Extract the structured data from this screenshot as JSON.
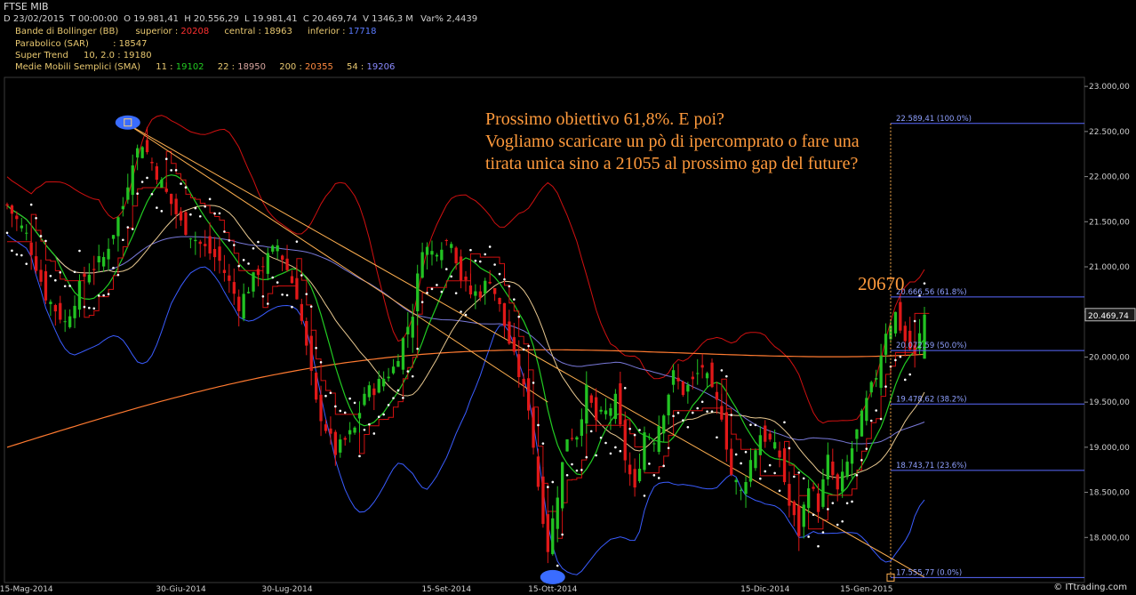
{
  "title": "FTSE MIB",
  "header_line": {
    "date": "D 23/02/2015",
    "time": "T 00:00:00",
    "open": "O 19.981,41",
    "high": "H 20.556,29",
    "low": "L 19.981,41",
    "close": "C 20.469,74",
    "volume": "V 1346,3 M",
    "var": "Var% 2,4439"
  },
  "indicators": {
    "bb_label": "Bande di Bollinger (BB)",
    "bb_sup_label": "superior :",
    "bb_sup": "20208",
    "bb_cen_label": "central :",
    "bb_cen": "18963",
    "bb_inf_label": "inferior :",
    "bb_inf": "17718",
    "sar_label": "Parabolico (SAR)",
    "sar_sep": ":",
    "sar": "18547",
    "st_label": "Super Trend",
    "st_params": "10, 2.0 :",
    "st": "19180",
    "sma_label": "Medie Mobili Semplici (SMA)",
    "sma": [
      {
        "period": "11 :",
        "value": "19102"
      },
      {
        "period": "22 :",
        "value": "18950"
      },
      {
        "period": "200 :",
        "value": "20355"
      },
      {
        "period": "54 :",
        "value": "19206"
      }
    ]
  },
  "colors": {
    "background": "#000000",
    "bull_candle": "#22c222",
    "bear_candle": "#e01818",
    "bb_upper": "#d01010",
    "bb_lower": "#3a5cff",
    "sma11": "#22cc22",
    "sma22": "#e8c890",
    "sma200": "#ff7a30",
    "sma54": "#7878d8",
    "supertrend": "#d01010",
    "sar": "#ffffff",
    "fib": "#5a6aff",
    "trendline": "#ffb050",
    "annotation": "#ff9a3c",
    "grid": "#2a2a2a"
  },
  "annotation": {
    "line1": "Prossimo obiettivo 61,8%. E poi?",
    "line2": "Vogliamo scaricare un pò di ipercomprato o fare una",
    "line3": "tirata unica sino a 21055 al prossimo gap del future?",
    "target": "20670"
  },
  "fib_levels": [
    {
      "label": "22.589,41 (100.0%)",
      "value": 22589.41
    },
    {
      "label": "20.666,56 (61.8%)",
      "value": 20666.56
    },
    {
      "label": "20.072,59 (50.0%)",
      "value": 20072.59
    },
    {
      "label": "19.478,62 (38.2%)",
      "value": 19478.62
    },
    {
      "label": "18.743,71 (23.6%)",
      "value": 18743.71
    },
    {
      "label": "17.555,77 (0.0%)",
      "value": 17555.77
    }
  ],
  "last_price_label": "20.469,74",
  "watermark": "© ITtrading.com",
  "chart_data": {
    "type": "candlestick",
    "title": "FTSE MIB",
    "ylim": [
      17500,
      23100
    ],
    "y_ticks": [
      {
        "label": "23.000,00",
        "value": 23000
      },
      {
        "label": "22.500,00",
        "value": 22500
      },
      {
        "label": "22.000,00",
        "value": 22000
      },
      {
        "label": "21.500,00",
        "value": 21500
      },
      {
        "label": "21.000,00",
        "value": 21000
      },
      {
        "label": "20.500,00",
        "value": 20500
      },
      {
        "label": "20.000,00",
        "value": 20000
      },
      {
        "label": "19.500,00",
        "value": 19500
      },
      {
        "label": "19.000,00",
        "value": 19000
      },
      {
        "label": "18.500,00",
        "value": 18500
      },
      {
        "label": "18.000,00",
        "value": 18000
      }
    ],
    "x_labels": [
      {
        "label": "15-Mag-2014",
        "index": 4
      },
      {
        "label": "30-Giu-2014",
        "index": 36
      },
      {
        "label": "30-Lug-2014",
        "index": 58
      },
      {
        "label": "15-Set-2014",
        "index": 91
      },
      {
        "label": "15-Ott-2014",
        "index": 113
      },
      {
        "label": "15-Dic-2014",
        "index": 157
      },
      {
        "label": "15-Gen-2015",
        "index": 178
      }
    ],
    "n_bars": 191,
    "close_anchors": [
      [
        0,
        21680
      ],
      [
        4,
        21350
      ],
      [
        8,
        20680
      ],
      [
        12,
        20380
      ],
      [
        16,
        20900
      ],
      [
        20,
        21100
      ],
      [
        24,
        21680
      ],
      [
        26,
        22200
      ],
      [
        28,
        22380
      ],
      [
        30,
        22150
      ],
      [
        32,
        21920
      ],
      [
        36,
        21480
      ],
      [
        40,
        21250
      ],
      [
        44,
        21060
      ],
      [
        48,
        20580
      ],
      [
        52,
        20960
      ],
      [
        56,
        21240
      ],
      [
        60,
        20700
      ],
      [
        64,
        19480
      ],
      [
        68,
        18950
      ],
      [
        72,
        19200
      ],
      [
        74,
        19600
      ],
      [
        76,
        19650
      ],
      [
        80,
        19880
      ],
      [
        84,
        20500
      ],
      [
        86,
        21240
      ],
      [
        88,
        21160
      ],
      [
        90,
        21260
      ],
      [
        92,
        21320
      ],
      [
        94,
        20880
      ],
      [
        96,
        20700
      ],
      [
        98,
        20720
      ],
      [
        100,
        20880
      ],
      [
        102,
        20550
      ],
      [
        104,
        20160
      ],
      [
        108,
        19460
      ],
      [
        110,
        18580
      ],
      [
        112,
        17880
      ],
      [
        114,
        18500
      ],
      [
        116,
        19120
      ],
      [
        118,
        19150
      ],
      [
        120,
        19620
      ],
      [
        122,
        19300
      ],
      [
        124,
        19380
      ],
      [
        126,
        19520
      ],
      [
        128,
        18880
      ],
      [
        130,
        18500
      ],
      [
        132,
        19170
      ],
      [
        134,
        19100
      ],
      [
        136,
        19420
      ],
      [
        138,
        19800
      ],
      [
        140,
        19620
      ],
      [
        142,
        19720
      ],
      [
        144,
        19900
      ],
      [
        146,
        19590
      ],
      [
        148,
        19370
      ],
      [
        150,
        18700
      ],
      [
        152,
        18500
      ],
      [
        154,
        18850
      ],
      [
        156,
        19150
      ],
      [
        158,
        19060
      ],
      [
        160,
        18900
      ],
      [
        162,
        18350
      ],
      [
        164,
        18050
      ],
      [
        166,
        18620
      ],
      [
        168,
        18340
      ],
      [
        170,
        18860
      ],
      [
        172,
        18500
      ],
      [
        174,
        18820
      ],
      [
        176,
        19160
      ],
      [
        178,
        19500
      ],
      [
        180,
        19800
      ],
      [
        182,
        20300
      ],
      [
        184,
        20480
      ],
      [
        186,
        20180
      ],
      [
        188,
        20000
      ],
      [
        190,
        20470
      ]
    ],
    "final_candle": {
      "open": 19981.41,
      "high": 20556.29,
      "low": 19981.41,
      "close": 20469.74
    },
    "series": [
      {
        "name": "Bande di Bollinger (BB) superior",
        "last": 20208
      },
      {
        "name": "Bande di Bollinger (BB) central",
        "last": 18963
      },
      {
        "name": "Bande di Bollinger (BB) inferior",
        "last": 17718
      },
      {
        "name": "Parabolico (SAR)",
        "last": 18547
      },
      {
        "name": "Super Trend",
        "last": 19180
      },
      {
        "name": "SMA 11",
        "last": 19102
      },
      {
        "name": "SMA 22",
        "last": 18950
      },
      {
        "name": "SMA 200",
        "last": 20355
      },
      {
        "name": "SMA 54",
        "last": 19206
      }
    ],
    "fib_range": {
      "start_index": 183,
      "high": 22589.41,
      "low": 17555.77
    },
    "trendlines": [
      {
        "from": [
          25,
          22580
        ],
        "to": [
          190,
          17560
        ]
      },
      {
        "from": [
          25,
          22580
        ],
        "to": [
          112,
          19500
        ]
      }
    ],
    "marked_points": [
      {
        "index": 25,
        "value": 22600
      },
      {
        "index": 113,
        "value": 17560
      }
    ],
    "grid": false
  }
}
